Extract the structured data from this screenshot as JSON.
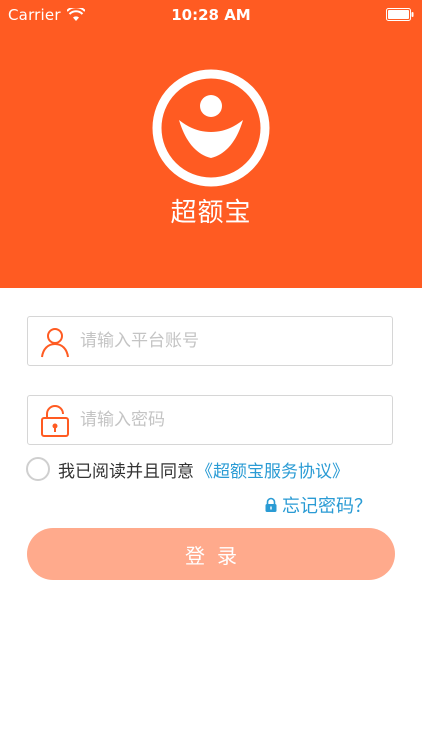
{
  "status_bar": {
    "carrier": "Carrier",
    "time": "10:28 AM"
  },
  "brand": {
    "name": "超额宝",
    "color": "#ff5b22"
  },
  "form": {
    "account_placeholder": "请输入平台账号",
    "password_placeholder": "请输入密码",
    "agree_text": "我已阅读并且同意",
    "agreement_link": "《超额宝服务协议》",
    "forgot_password": "忘记密码？",
    "login_button": "登录"
  },
  "icons": {
    "account": "user-icon",
    "password": "lock-icon",
    "forgot": "small-lock-icon"
  },
  "colors": {
    "header_bg": "#ff5b22",
    "button_bg": "#ffaa8c",
    "link": "#2a9bd4"
  }
}
